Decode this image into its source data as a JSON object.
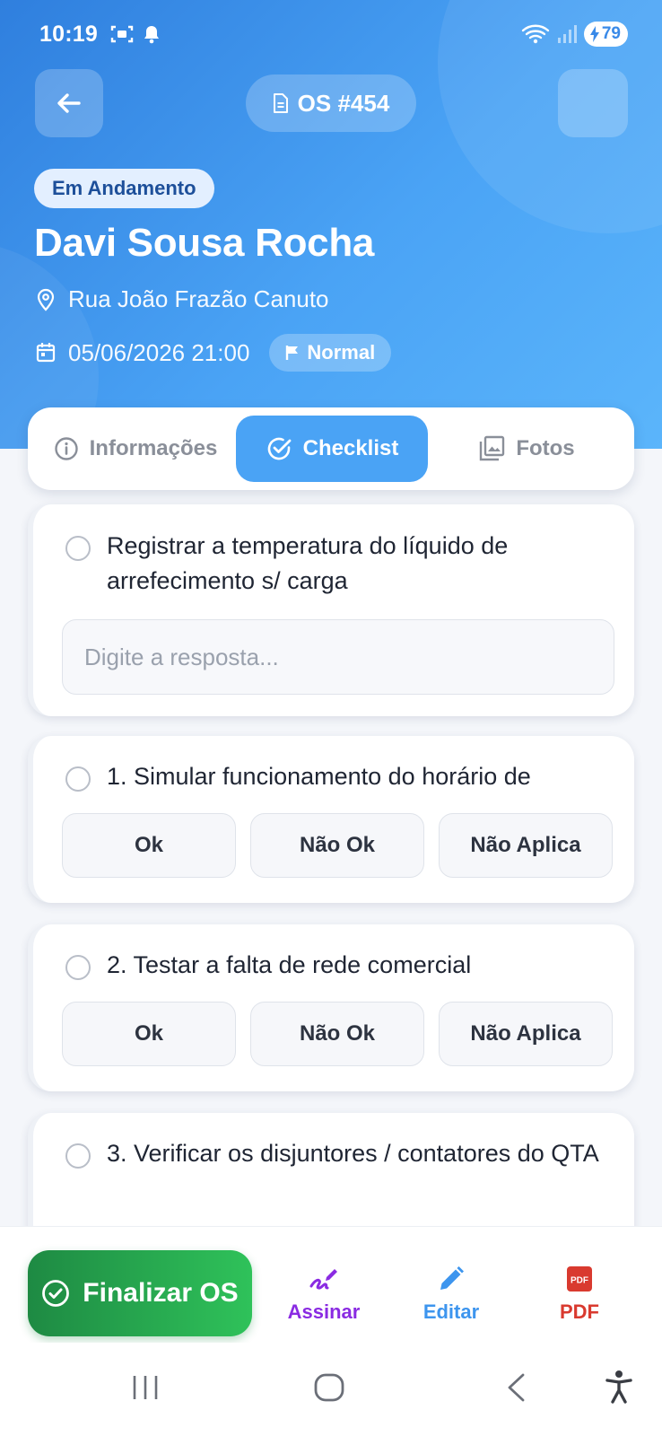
{
  "statusbar": {
    "time": "10:19",
    "battery": "79"
  },
  "header": {
    "os_label": "OS #454",
    "status_badge": "Em Andamento",
    "client_name": "Davi Sousa Rocha",
    "address": "Rua João Frazão Canuto",
    "datetime": "05/06/2026 21:00",
    "priority": "Normal"
  },
  "tabs": [
    {
      "label": "Informações",
      "active": false
    },
    {
      "label": "Checklist",
      "active": true
    },
    {
      "label": "Fotos",
      "active": false
    }
  ],
  "checklist": {
    "items": [
      {
        "text": "Registrar a temperatura do líquido de arrefecimento s/ carga",
        "type": "text",
        "placeholder": "Digite a resposta..."
      },
      {
        "text": "1. Simular funcionamento do horário de",
        "type": "options"
      },
      {
        "text": "2. Testar a falta de rede comercial",
        "type": "options"
      },
      {
        "text": "3. Verificar os disjuntores / contatores do QTA",
        "type": "options"
      }
    ],
    "options": [
      "Ok",
      "Não Ok",
      "Não Aplica"
    ]
  },
  "actions": {
    "finalize": "Finalizar OS",
    "sign": "Assinar",
    "edit": "Editar",
    "pdf": "PDF",
    "pdf_icon_text": "PDF"
  },
  "colors": {
    "header_start": "#2f7fde",
    "header_end": "#5bb5fb",
    "accent": "#4aa3f5",
    "finalize": "#2fc25a",
    "sign": "#8a2be2",
    "edit": "#3d95ee",
    "pdf": "#d93a2f"
  }
}
